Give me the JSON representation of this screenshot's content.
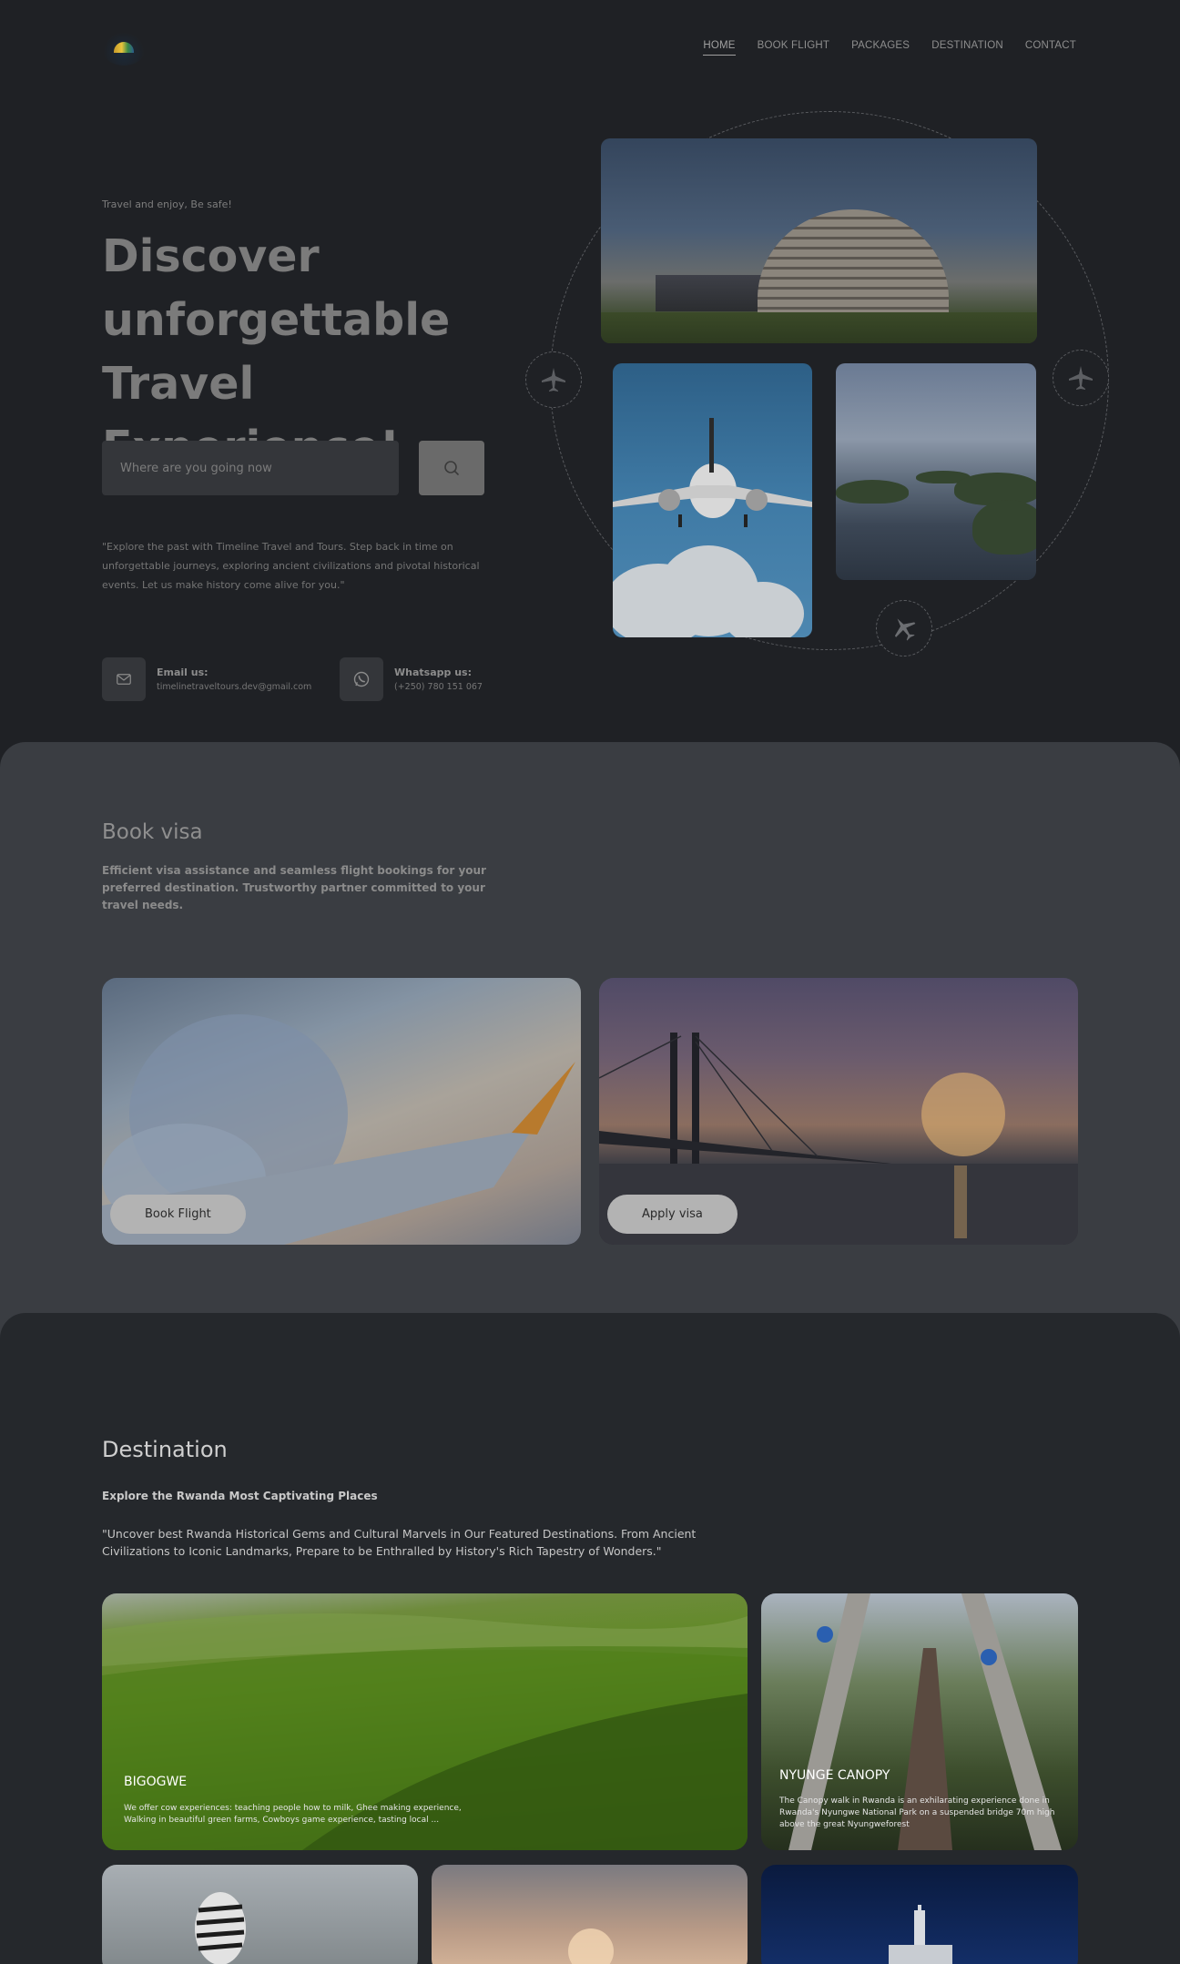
{
  "nav": {
    "links": [
      "HOME",
      "BOOK FLIGHT",
      "PACKAGES",
      "DESTINATION",
      "CONTACT"
    ]
  },
  "hero": {
    "tagline": "Travel and enjoy, Be safe!",
    "title_line1": "Discover",
    "title_line2": "unforgettable",
    "title_line3": "Travel Experience!",
    "search_placeholder": "Where are you going now",
    "description": "\"Explore the past with Timeline Travel and Tours. Step back in time on unforgettable journeys, exploring ancient civilizations and pivotal historical events. Let us make history come alive for you.\"",
    "email_label": "Email us:",
    "email_value": "timelinetraveltours.dev@gmail.com",
    "whatsapp_label": "Whatsapp us:",
    "whatsapp_value": "(+250) 780 151 067"
  },
  "visa": {
    "title": "Book visa",
    "subtitle": "Efficient visa assistance and seamless flight bookings for your preferred destination. Trustworthy partner committed to your travel needs.",
    "book_flight_label": "Book Flight",
    "apply_visa_label": "Apply visa"
  },
  "destination": {
    "title": "Destination",
    "subtitle": "Explore the Rwanda Most Captivating Places",
    "description": "\"Uncover best Rwanda Historical Gems and Cultural Marvels in Our Featured Destinations. From Ancient Civilizations to Iconic Landmarks, Prepare to be Enthralled by History's Rich Tapestry of Wonders.\"",
    "cards": [
      {
        "title": "BIGOGWE",
        "text": "We offer cow experiences: teaching people how to milk, Ghee making experience, Walking in beautiful green farms, Cowboys game experience, tasting local ..."
      },
      {
        "title": "NYUNGE CANOPY",
        "text": "The Canopy walk in Rwanda is an exhilarating experience done in Rwanda's Nyungwe National Park on a suspended bridge 70m high above the great Nyungweforest"
      }
    ]
  },
  "icons": {
    "search": "search-icon",
    "mail": "mail-icon",
    "whatsapp": "whatsapp-icon",
    "plane": "plane-icon"
  }
}
